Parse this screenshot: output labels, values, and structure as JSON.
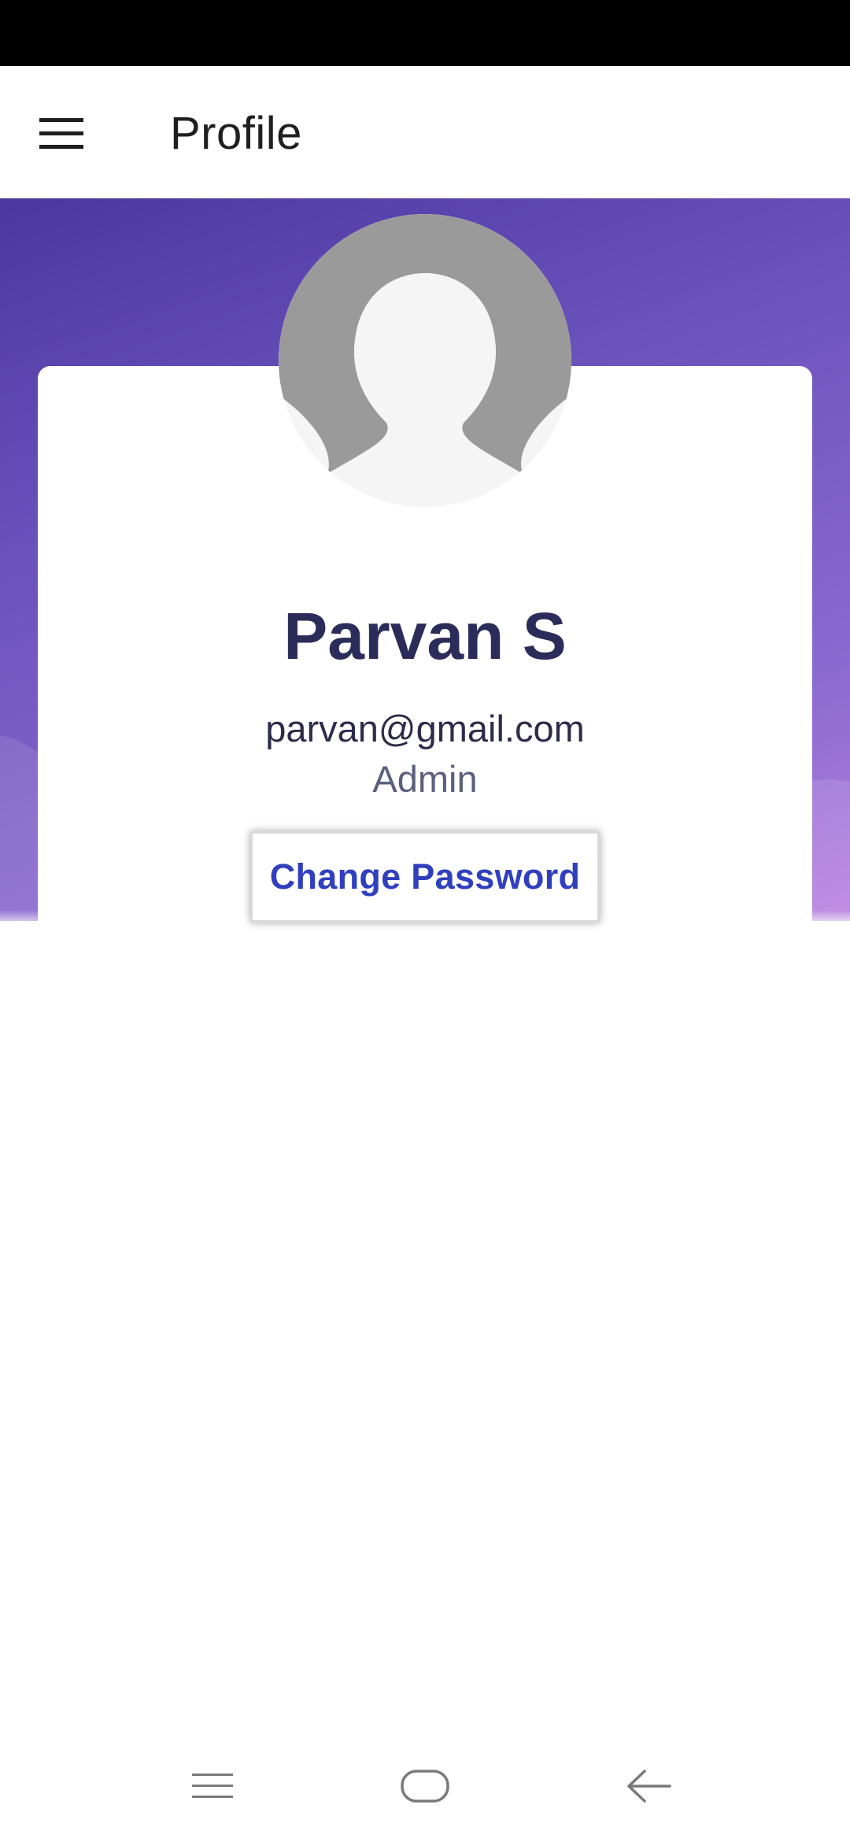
{
  "app_bar": {
    "title": "Profile",
    "menu_icon": "hamburger-menu-icon"
  },
  "profile": {
    "avatar_icon": "default-avatar-icon",
    "name": "Parvan S",
    "email": "parvan@gmail.com",
    "role": "Admin",
    "change_password_label": "Change Password"
  },
  "system_nav": {
    "recents_icon": "recents-icon",
    "home_icon": "home-icon",
    "back_icon": "back-arrow-icon"
  },
  "colors": {
    "gradient_start": "#4b36a0",
    "gradient_end": "#b87ee0",
    "name_color": "#2c2c5a",
    "button_text": "#2f3fbe"
  }
}
